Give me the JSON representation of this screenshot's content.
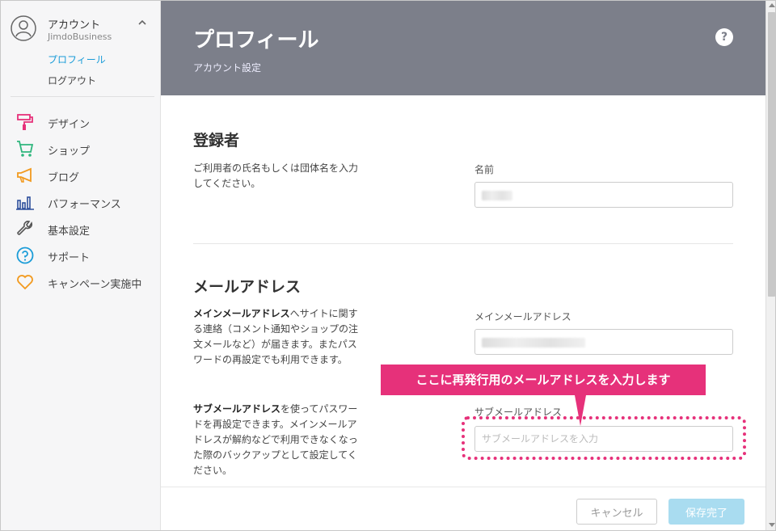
{
  "sidebar": {
    "account_name": "アカウント",
    "account_plan": "JimdoBusiness",
    "profile_link": "プロフィール",
    "logout_link": "ログアウト",
    "items": [
      {
        "label": "デザイン",
        "icon": "paint-roller-icon",
        "color": "#e6317a"
      },
      {
        "label": "ショップ",
        "icon": "cart-icon",
        "color": "#2fb67d"
      },
      {
        "label": "ブログ",
        "icon": "megaphone-icon",
        "color": "#f29a1f"
      },
      {
        "label": "パフォーマンス",
        "icon": "bar-chart-icon",
        "color": "#2d4f9c"
      },
      {
        "label": "基本設定",
        "icon": "wrench-icon",
        "color": "#555555"
      },
      {
        "label": "サポート",
        "icon": "question-icon",
        "color": "#1a9cd8"
      },
      {
        "label": "キャンペーン実施中",
        "icon": "heart-icon",
        "color": "#f29a1f"
      }
    ]
  },
  "header": {
    "title": "プロフィール",
    "subtitle": "アカウント設定",
    "help": "?"
  },
  "registrant": {
    "title": "登録者",
    "description": "ご利用者の氏名もしくは団体名を入力してください。",
    "name_label": "名前"
  },
  "email": {
    "title": "メールアドレス",
    "main_desc_bold": "メインメールアドレス",
    "main_desc_rest": "へサイトに関する連絡（コメント通知やショップの注文メールなど）が届きます。またパスワードの再設定でも利用できます。",
    "main_label": "メインメールアドレス",
    "sub_desc_bold": "サブメールアドレス",
    "sub_desc_rest": "を使ってパスワードを再設定できます。メインメールアドレスが解約などで利用できなくなった際のバックアップとして設定してください。",
    "sub_label": "サブメールアドレス",
    "sub_placeholder": "サブメールアドレスを入力"
  },
  "footer": {
    "cancel": "キャンセル",
    "save": "保存完了"
  },
  "annotation": {
    "text": "ここに再発行用のメールアドレスを入力します",
    "color": "#e6317a"
  }
}
